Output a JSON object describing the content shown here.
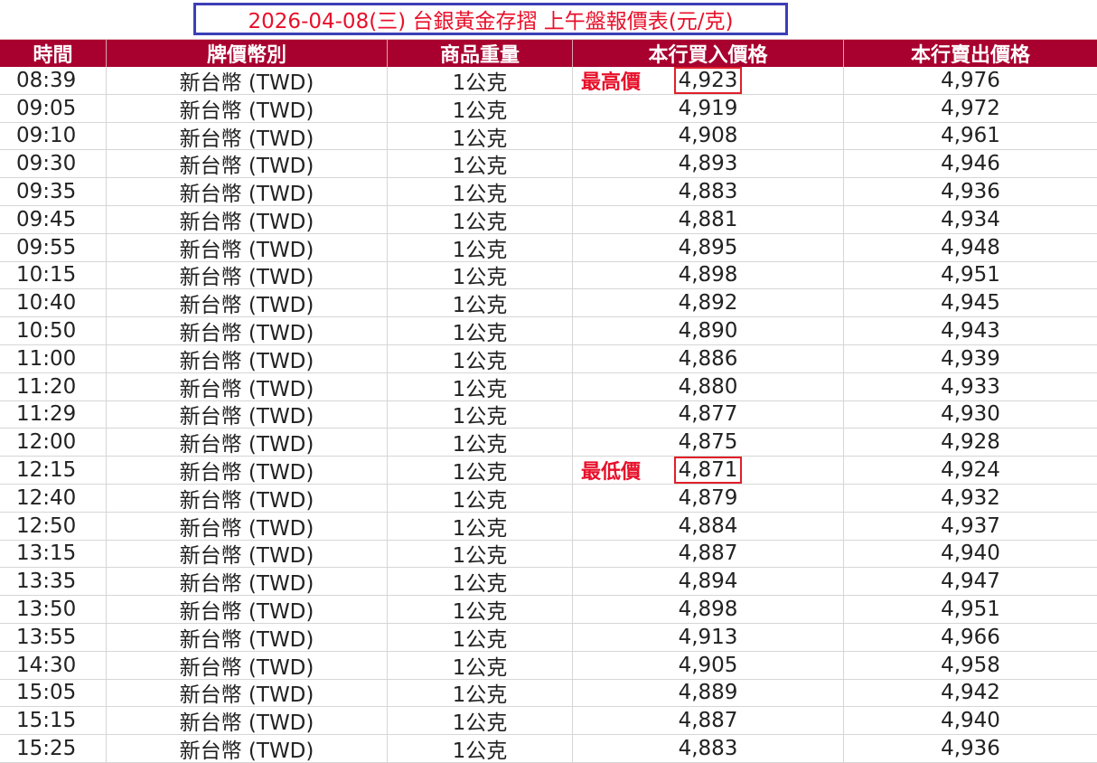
{
  "title": "2026-04-08(三)  台銀黃金存摺  上午盤報價表(元/克)",
  "colors": {
    "header_bg": "#a8002f",
    "title_text": "#e8102a",
    "title_border": "#3b3fb6",
    "highlight_box": "#e0202a"
  },
  "table": {
    "headers": [
      "時間",
      "牌價幣別",
      "商品重量",
      "本行買入價格",
      "本行賣出價格"
    ],
    "rows": [
      {
        "time": "08:39",
        "currency": "新台幣 (TWD)",
        "weight": "1公克",
        "buy": "4,923",
        "sell": "4,976",
        "tag": "最高價",
        "boxed": true
      },
      {
        "time": "09:05",
        "currency": "新台幣 (TWD)",
        "weight": "1公克",
        "buy": "4,919",
        "sell": "4,972"
      },
      {
        "time": "09:10",
        "currency": "新台幣 (TWD)",
        "weight": "1公克",
        "buy": "4,908",
        "sell": "4,961"
      },
      {
        "time": "09:30",
        "currency": "新台幣 (TWD)",
        "weight": "1公克",
        "buy": "4,893",
        "sell": "4,946"
      },
      {
        "time": "09:35",
        "currency": "新台幣 (TWD)",
        "weight": "1公克",
        "buy": "4,883",
        "sell": "4,936"
      },
      {
        "time": "09:45",
        "currency": "新台幣 (TWD)",
        "weight": "1公克",
        "buy": "4,881",
        "sell": "4,934"
      },
      {
        "time": "09:55",
        "currency": "新台幣 (TWD)",
        "weight": "1公克",
        "buy": "4,895",
        "sell": "4,948"
      },
      {
        "time": "10:15",
        "currency": "新台幣 (TWD)",
        "weight": "1公克",
        "buy": "4,898",
        "sell": "4,951"
      },
      {
        "time": "10:40",
        "currency": "新台幣 (TWD)",
        "weight": "1公克",
        "buy": "4,892",
        "sell": "4,945"
      },
      {
        "time": "10:50",
        "currency": "新台幣 (TWD)",
        "weight": "1公克",
        "buy": "4,890",
        "sell": "4,943"
      },
      {
        "time": "11:00",
        "currency": "新台幣 (TWD)",
        "weight": "1公克",
        "buy": "4,886",
        "sell": "4,939"
      },
      {
        "time": "11:20",
        "currency": "新台幣 (TWD)",
        "weight": "1公克",
        "buy": "4,880",
        "sell": "4,933"
      },
      {
        "time": "11:29",
        "currency": "新台幣 (TWD)",
        "weight": "1公克",
        "buy": "4,877",
        "sell": "4,930"
      },
      {
        "time": "12:00",
        "currency": "新台幣 (TWD)",
        "weight": "1公克",
        "buy": "4,875",
        "sell": "4,928"
      },
      {
        "time": "12:15",
        "currency": "新台幣 (TWD)",
        "weight": "1公克",
        "buy": "4,871",
        "sell": "4,924",
        "tag": "最低價",
        "boxed": true
      },
      {
        "time": "12:40",
        "currency": "新台幣 (TWD)",
        "weight": "1公克",
        "buy": "4,879",
        "sell": "4,932"
      },
      {
        "time": "12:50",
        "currency": "新台幣 (TWD)",
        "weight": "1公克",
        "buy": "4,884",
        "sell": "4,937"
      },
      {
        "time": "13:15",
        "currency": "新台幣 (TWD)",
        "weight": "1公克",
        "buy": "4,887",
        "sell": "4,940"
      },
      {
        "time": "13:35",
        "currency": "新台幣 (TWD)",
        "weight": "1公克",
        "buy": "4,894",
        "sell": "4,947"
      },
      {
        "time": "13:50",
        "currency": "新台幣 (TWD)",
        "weight": "1公克",
        "buy": "4,898",
        "sell": "4,951"
      },
      {
        "time": "13:55",
        "currency": "新台幣 (TWD)",
        "weight": "1公克",
        "buy": "4,913",
        "sell": "4,966"
      },
      {
        "time": "14:30",
        "currency": "新台幣 (TWD)",
        "weight": "1公克",
        "buy": "4,905",
        "sell": "4,958"
      },
      {
        "time": "15:05",
        "currency": "新台幣 (TWD)",
        "weight": "1公克",
        "buy": "4,889",
        "sell": "4,942"
      },
      {
        "time": "15:15",
        "currency": "新台幣 (TWD)",
        "weight": "1公克",
        "buy": "4,887",
        "sell": "4,940"
      },
      {
        "time": "15:25",
        "currency": "新台幣 (TWD)",
        "weight": "1公克",
        "buy": "4,883",
        "sell": "4,936"
      }
    ]
  }
}
